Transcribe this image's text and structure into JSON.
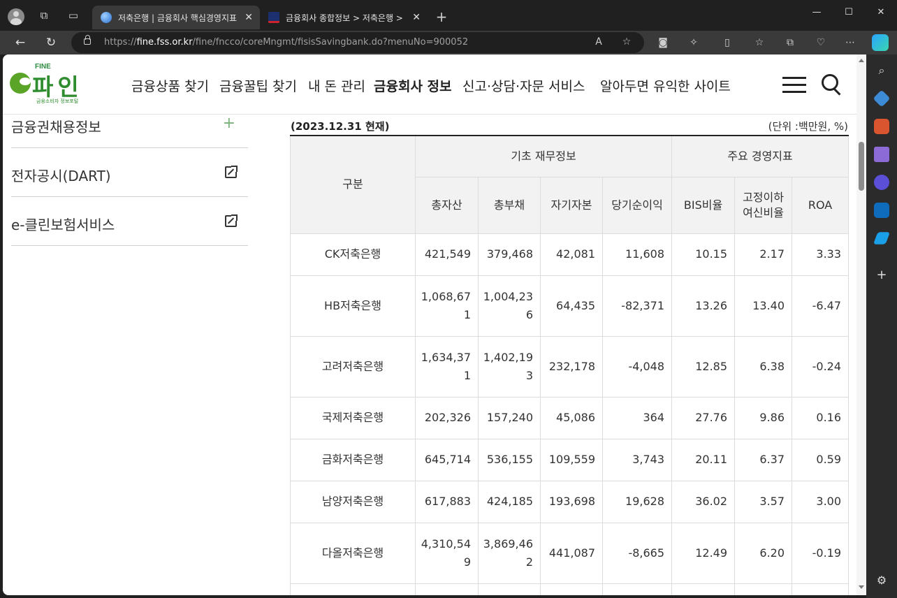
{
  "browser": {
    "tabs": [
      {
        "title": "저축은행 | 금융회사 핵심경영지표",
        "active": true
      },
      {
        "title": "금융회사 종합정보 > 저축은행 >",
        "active": false
      }
    ],
    "url_scheme": "https://",
    "url_host": "fine.fss.or.kr",
    "url_path": "/fine/fncco/coreMngmt/fisisSavingbank.do?menuNo=900052"
  },
  "site": {
    "logo_small": "FINE",
    "logo_word": "파인",
    "logo_tagline": "금융소비자 정보포털",
    "nav": [
      {
        "label": "금융상품 찾기",
        "active": false
      },
      {
        "label": "금융꿀팁 찾기",
        "active": false
      },
      {
        "label": "내 돈 관리",
        "active": false
      },
      {
        "label": "금융회사 정보",
        "active": true
      },
      {
        "label": "신고·상담·자문 서비스",
        "active": false
      },
      {
        "label": "알아두면 유익한 사이트",
        "active": false
      }
    ]
  },
  "sidebar": {
    "items": [
      {
        "label": "금융권채용정보",
        "icon": "plus-icon"
      },
      {
        "label": "전자공시(DART)",
        "icon": "external-link-icon"
      },
      {
        "label": "e-클린보험서비스",
        "icon": "external-link-icon"
      }
    ]
  },
  "table": {
    "as_of": "(2023.12.31 현재)",
    "unit": "(단위 :백만원, %)",
    "header_group": "구분",
    "header_fin": "기초 재무정보",
    "header_mgmt": "주요 경영지표",
    "columns": [
      "총자산",
      "총부채",
      "자기자본",
      "당기순이익",
      "BIS비율",
      "고정이하\n여신비율",
      "ROA"
    ],
    "rows": [
      {
        "name": "CK저축은행",
        "total_assets": "421,549",
        "total_liabilities": "379,468",
        "equity": "42,081",
        "net_income": "11,608",
        "bis": "10.15",
        "npl": "2.17",
        "roa": "3.33"
      },
      {
        "name": "HB저축은행",
        "total_assets": "1,068,671",
        "total_liabilities": "1,004,236",
        "equity": "64,435",
        "net_income": "-82,371",
        "bis": "13.26",
        "npl": "13.40",
        "roa": "-6.47"
      },
      {
        "name": "고려저축은행",
        "total_assets": "1,634,371",
        "total_liabilities": "1,402,193",
        "equity": "232,178",
        "net_income": "-4,048",
        "bis": "12.85",
        "npl": "6.38",
        "roa": "-0.24"
      },
      {
        "name": "국제저축은행",
        "total_assets": "202,326",
        "total_liabilities": "157,240",
        "equity": "45,086",
        "net_income": "364",
        "bis": "27.76",
        "npl": "9.86",
        "roa": "0.16"
      },
      {
        "name": "금화저축은행",
        "total_assets": "645,714",
        "total_liabilities": "536,155",
        "equity": "109,559",
        "net_income": "3,743",
        "bis": "20.11",
        "npl": "6.37",
        "roa": "0.59"
      },
      {
        "name": "남양저축은행",
        "total_assets": "617,883",
        "total_liabilities": "424,185",
        "equity": "193,698",
        "net_income": "19,628",
        "bis": "36.02",
        "npl": "3.57",
        "roa": "3.00"
      },
      {
        "name": "다올저축은행",
        "total_assets": "4,310,549",
        "total_liabilities": "3,869,462",
        "equity": "441,087",
        "net_income": "-8,665",
        "bis": "12.49",
        "npl": "6.20",
        "roa": "-0.19"
      }
    ]
  },
  "colors": {
    "brand_green": "#2f8d2f",
    "browser_dark": "#202020"
  }
}
